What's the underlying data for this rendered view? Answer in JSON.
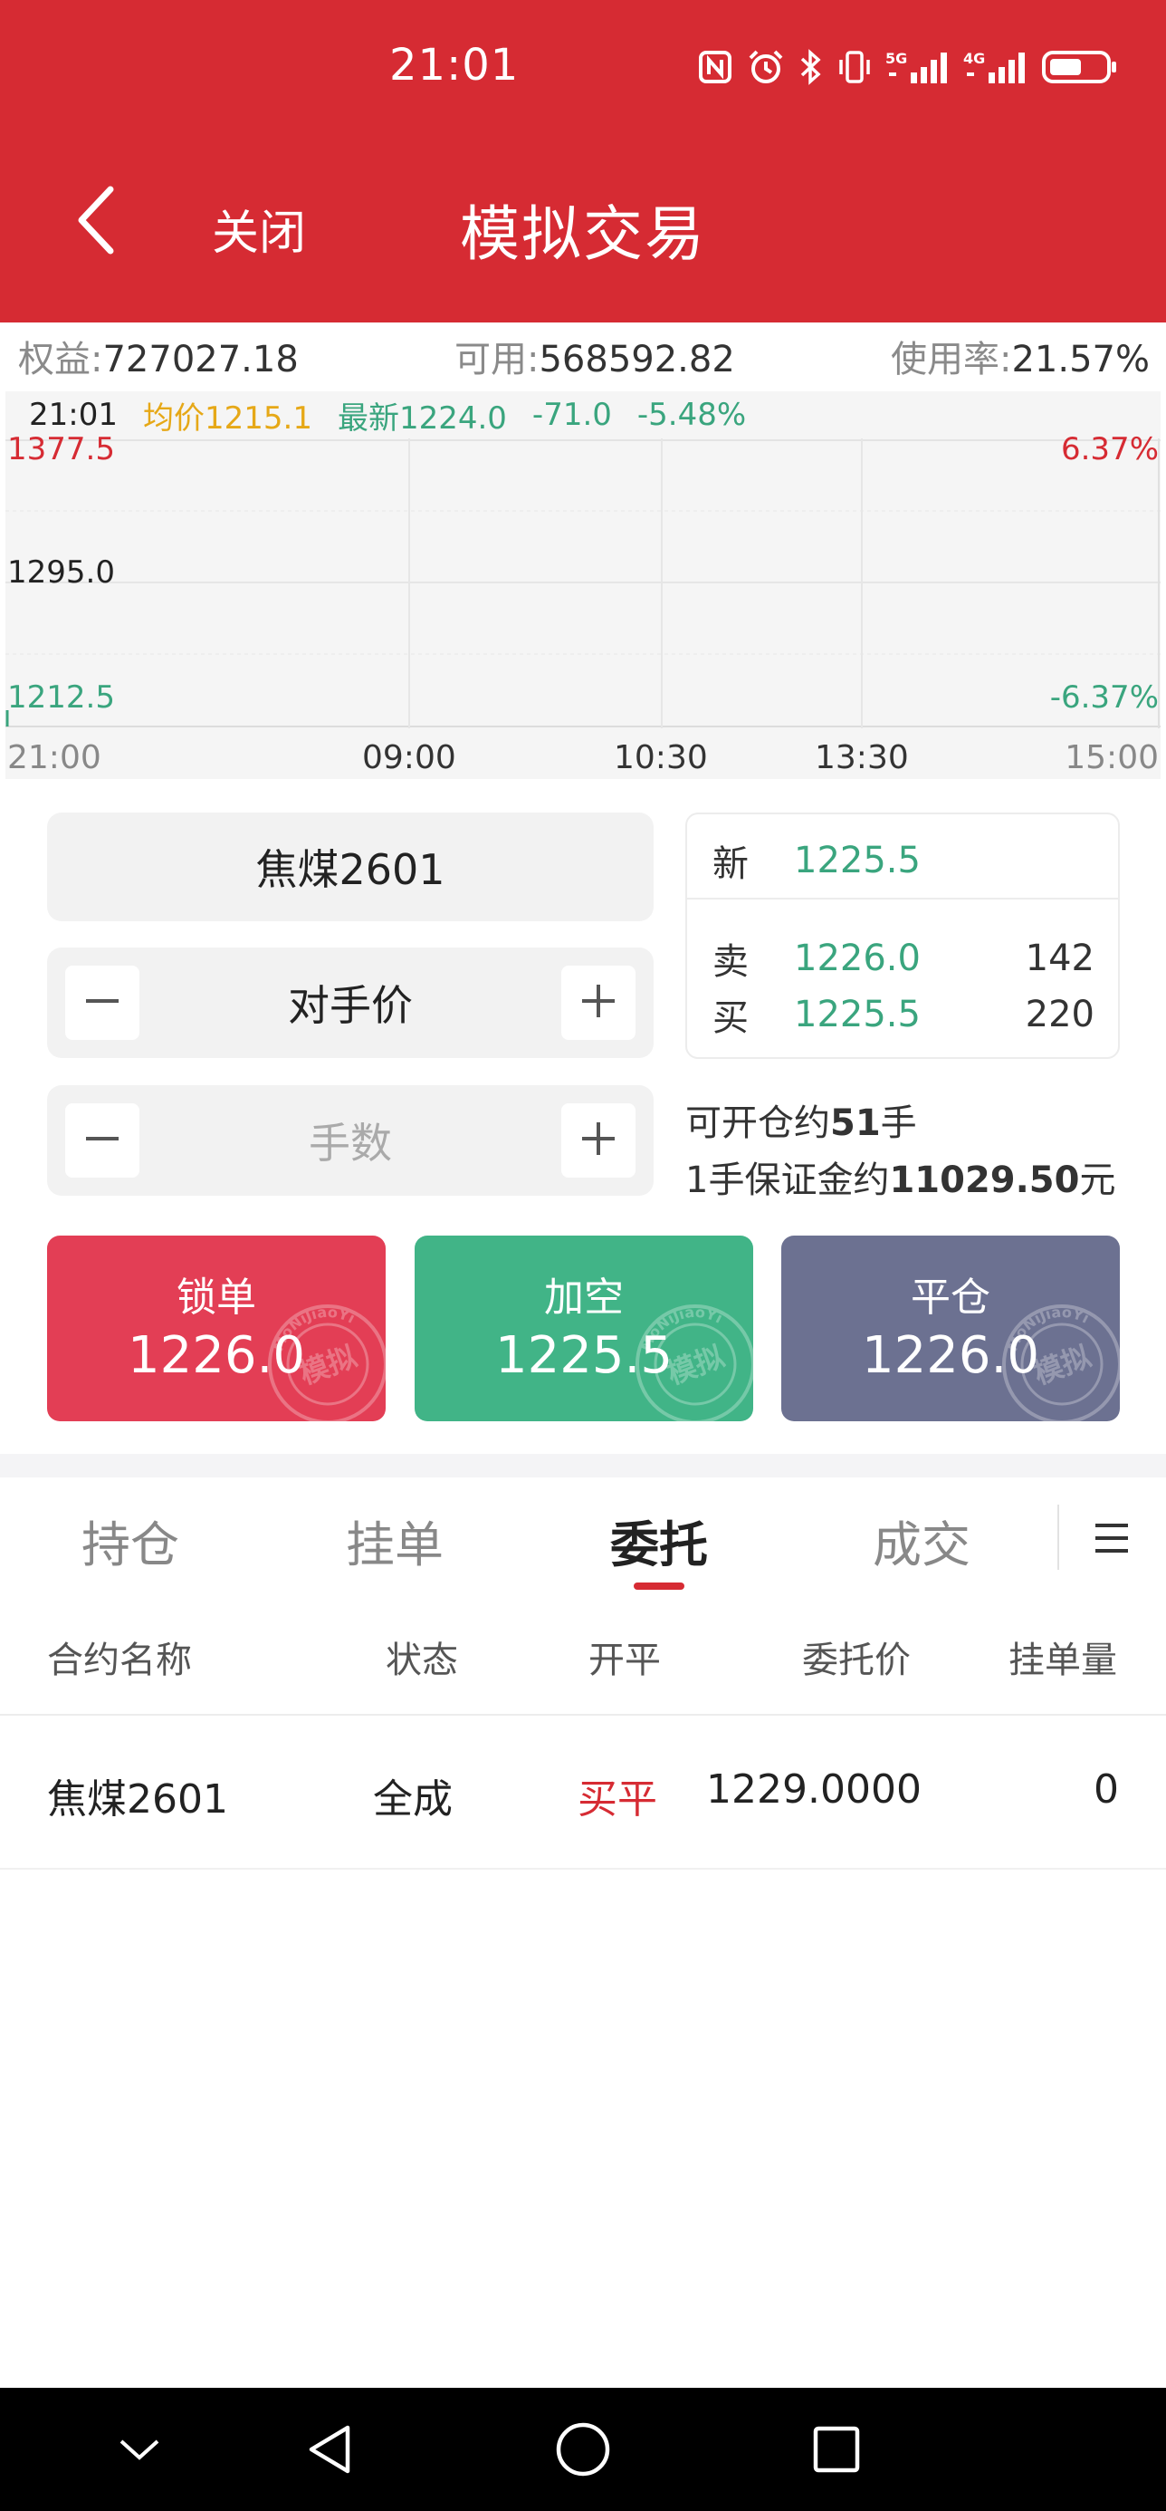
{
  "status_bar": {
    "time": "21:01",
    "icons": [
      "nfc-icon",
      "alarm-icon",
      "bluetooth-icon",
      "vibrate-icon",
      "signal-5g-icon",
      "signal-4g-icon",
      "battery-icon"
    ],
    "signal_5g_label": "5G",
    "signal_4g_label": "4G"
  },
  "header": {
    "back_icon": "chevron-left-icon",
    "close_label": "关闭",
    "title": "模拟交易"
  },
  "account": {
    "equity_label": "权益:",
    "equity_value": "727027.18",
    "available_label": "可用:",
    "available_value": "568592.82",
    "usage_label": "使用率:",
    "usage_value": "21.57%"
  },
  "chart": {
    "time": "21:01",
    "avg_price": "均价1215.1",
    "latest_price": "最新1224.0",
    "change": "-71.0",
    "change_pct": "-5.48%",
    "y_high": "1377.5",
    "y_mid": "1295.0",
    "y_low": "1212.5",
    "pct_high": "6.37%",
    "pct_low": "-6.37%",
    "x_ticks": [
      "21:00",
      "09:00",
      "10:30",
      "13:30",
      "15:00"
    ],
    "colors": {
      "up": "#d62b33",
      "down": "#3aa57e",
      "avg": "#e6a817"
    }
  },
  "chart_data": {
    "type": "line",
    "title": "",
    "xlabel": "",
    "ylabel": "",
    "x": [
      "21:00",
      "09:00",
      "10:30",
      "13:30",
      "15:00"
    ],
    "ylim": [
      1212.5,
      1377.5
    ],
    "y_ticks": [
      1377.5,
      1295.0,
      1212.5
    ],
    "y2_ticks": [
      "6.37%",
      "-6.37%"
    ],
    "series": [],
    "grid": true
  },
  "order": {
    "contract": "焦煤2601",
    "price_type": "对手价",
    "lots_placeholder": "手数",
    "minus_icon": "minus-icon",
    "plus_icon": "plus-icon"
  },
  "quote": {
    "latest_label": "新",
    "latest_price": "1225.5",
    "ask_label": "卖",
    "ask_price": "1226.0",
    "ask_volume": "142",
    "bid_label": "买",
    "bid_price": "1225.5",
    "bid_volume": "220"
  },
  "availability": {
    "open_prefix": "可开仓约",
    "open_lots": "51",
    "open_suffix": "手",
    "margin_prefix": "1手保证金约",
    "margin_value": "11029.50",
    "margin_suffix": "元"
  },
  "actions": [
    {
      "label": "锁单",
      "price": "1226.0",
      "color": "#e33e55"
    },
    {
      "label": "加空",
      "price": "1225.5",
      "color": "#41b487"
    },
    {
      "label": "平仓",
      "price": "1226.0",
      "color": "#6c7191"
    }
  ],
  "watermark": {
    "arc_text": "MoNiJiaoYi",
    "center_text": "模拟"
  },
  "tabs": {
    "items": [
      "持仓",
      "挂单",
      "委托",
      "成交"
    ],
    "active": "委托",
    "menu_icon": "menu-icon"
  },
  "orders_table": {
    "headers": [
      "合约名称",
      "状态",
      "开平",
      "委托价",
      "挂单量"
    ],
    "rows": [
      {
        "contract": "焦煤2601",
        "status": "全成",
        "open_close": "买平",
        "price": "1229.0000",
        "pending": "0"
      }
    ]
  },
  "nav_bar": {
    "icons": [
      "collapse-icon",
      "back-triangle-icon",
      "home-circle-icon",
      "recents-square-icon"
    ]
  }
}
